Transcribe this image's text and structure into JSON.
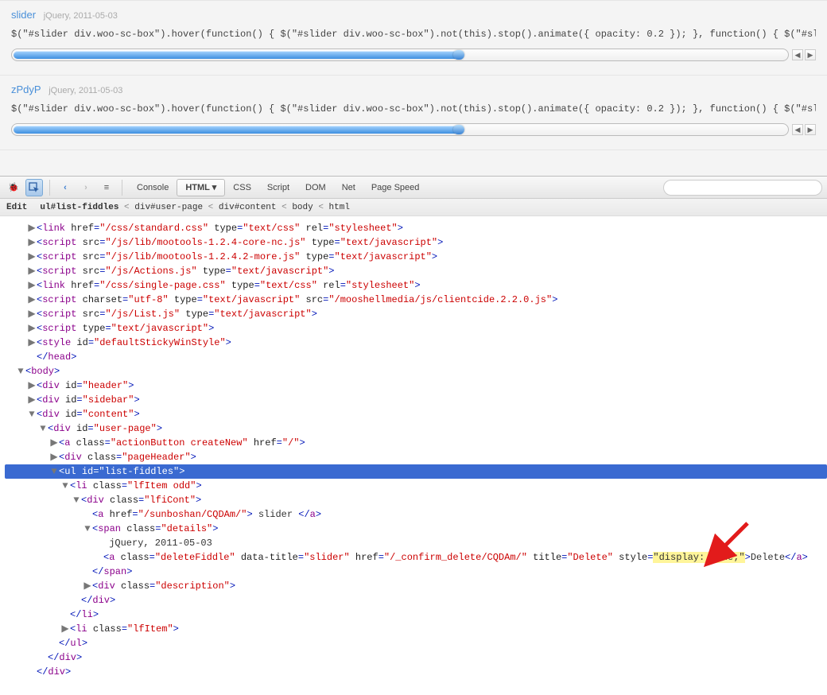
{
  "fiddles": [
    {
      "title": "slider",
      "meta": "jQuery, 2011-05-03",
      "code": "$(\"#slider div.woo-sc-box\").hover(function() { $(\"#slider div.woo-sc-box\").not(this).stop().animate({ opacity: 0.2 }); }, function() { $(\"#slider d"
    },
    {
      "title": "zPdyP",
      "meta": "jQuery, 2011-05-03",
      "code": "$(\"#slider div.woo-sc-box\").hover(function() { $(\"#slider div.woo-sc-box\").not(this).stop().animate({ opacity: 0.2 }); }, function() { $(\"#slider d"
    }
  ],
  "toolbar": {
    "tabs": [
      "Console",
      "HTML",
      "CSS",
      "Script",
      "DOM",
      "Net",
      "Page Speed"
    ],
    "active_tab_index": 1,
    "search_placeholder": ""
  },
  "breadcrumbs": {
    "edit": "Edit",
    "items": [
      "ul#list-fiddles",
      "div#user-page",
      "div#content",
      "body",
      "html"
    ],
    "sep": "<"
  },
  "tree": [
    {
      "d": 2,
      "tw": "▶",
      "html": [
        [
          "pun",
          "<"
        ],
        [
          "tag",
          "link"
        ],
        [
          "txt",
          " "
        ],
        [
          "attr",
          "href"
        ],
        [
          "pun",
          "="
        ],
        [
          "val",
          "\"/css/standard.css\""
        ],
        [
          "txt",
          " "
        ],
        [
          "attr",
          "type"
        ],
        [
          "pun",
          "="
        ],
        [
          "val",
          "\"text/css\""
        ],
        [
          "txt",
          " "
        ],
        [
          "attr",
          "rel"
        ],
        [
          "pun",
          "="
        ],
        [
          "val",
          "\"stylesheet\""
        ],
        [
          "pun",
          ">"
        ]
      ]
    },
    {
      "d": 2,
      "tw": "▶",
      "html": [
        [
          "pun",
          "<"
        ],
        [
          "tag",
          "script"
        ],
        [
          "txt",
          " "
        ],
        [
          "attr",
          "src"
        ],
        [
          "pun",
          "="
        ],
        [
          "val",
          "\"/js/lib/mootools-1.2.4-core-nc.js\""
        ],
        [
          "txt",
          " "
        ],
        [
          "attr",
          "type"
        ],
        [
          "pun",
          "="
        ],
        [
          "val",
          "\"text/javascript\""
        ],
        [
          "pun",
          ">"
        ]
      ]
    },
    {
      "d": 2,
      "tw": "▶",
      "html": [
        [
          "pun",
          "<"
        ],
        [
          "tag",
          "script"
        ],
        [
          "txt",
          " "
        ],
        [
          "attr",
          "src"
        ],
        [
          "pun",
          "="
        ],
        [
          "val",
          "\"/js/lib/mootools-1.2.4.2-more.js\""
        ],
        [
          "txt",
          " "
        ],
        [
          "attr",
          "type"
        ],
        [
          "pun",
          "="
        ],
        [
          "val",
          "\"text/javascript\""
        ],
        [
          "pun",
          ">"
        ]
      ]
    },
    {
      "d": 2,
      "tw": "▶",
      "html": [
        [
          "pun",
          "<"
        ],
        [
          "tag",
          "script"
        ],
        [
          "txt",
          " "
        ],
        [
          "attr",
          "src"
        ],
        [
          "pun",
          "="
        ],
        [
          "val",
          "\"/js/Actions.js\""
        ],
        [
          "txt",
          " "
        ],
        [
          "attr",
          "type"
        ],
        [
          "pun",
          "="
        ],
        [
          "val",
          "\"text/javascript\""
        ],
        [
          "pun",
          ">"
        ]
      ]
    },
    {
      "d": 2,
      "tw": "▶",
      "html": [
        [
          "pun",
          "<"
        ],
        [
          "tag",
          "link"
        ],
        [
          "txt",
          " "
        ],
        [
          "attr",
          "href"
        ],
        [
          "pun",
          "="
        ],
        [
          "val",
          "\"/css/single-page.css\""
        ],
        [
          "txt",
          " "
        ],
        [
          "attr",
          "type"
        ],
        [
          "pun",
          "="
        ],
        [
          "val",
          "\"text/css\""
        ],
        [
          "txt",
          " "
        ],
        [
          "attr",
          "rel"
        ],
        [
          "pun",
          "="
        ],
        [
          "val",
          "\"stylesheet\""
        ],
        [
          "pun",
          ">"
        ]
      ]
    },
    {
      "d": 2,
      "tw": "▶",
      "html": [
        [
          "pun",
          "<"
        ],
        [
          "tag",
          "script"
        ],
        [
          "txt",
          " "
        ],
        [
          "attr",
          "charset"
        ],
        [
          "pun",
          "="
        ],
        [
          "val",
          "\"utf-8\""
        ],
        [
          "txt",
          " "
        ],
        [
          "attr",
          "type"
        ],
        [
          "pun",
          "="
        ],
        [
          "val",
          "\"text/javascript\""
        ],
        [
          "txt",
          " "
        ],
        [
          "attr",
          "src"
        ],
        [
          "pun",
          "="
        ],
        [
          "val",
          "\"/mooshellmedia/js/clientcide.2.2.0.js\""
        ],
        [
          "pun",
          ">"
        ]
      ]
    },
    {
      "d": 2,
      "tw": "▶",
      "html": [
        [
          "pun",
          "<"
        ],
        [
          "tag",
          "script"
        ],
        [
          "txt",
          " "
        ],
        [
          "attr",
          "src"
        ],
        [
          "pun",
          "="
        ],
        [
          "val",
          "\"/js/List.js\""
        ],
        [
          "txt",
          " "
        ],
        [
          "attr",
          "type"
        ],
        [
          "pun",
          "="
        ],
        [
          "val",
          "\"text/javascript\""
        ],
        [
          "pun",
          ">"
        ]
      ]
    },
    {
      "d": 2,
      "tw": "▶",
      "html": [
        [
          "pun",
          "<"
        ],
        [
          "tag",
          "script"
        ],
        [
          "txt",
          " "
        ],
        [
          "attr",
          "type"
        ],
        [
          "pun",
          "="
        ],
        [
          "val",
          "\"text/javascript\""
        ],
        [
          "pun",
          ">"
        ]
      ]
    },
    {
      "d": 2,
      "tw": "▶",
      "html": [
        [
          "pun",
          "<"
        ],
        [
          "tag",
          "style"
        ],
        [
          "txt",
          " "
        ],
        [
          "attr",
          "id"
        ],
        [
          "pun",
          "="
        ],
        [
          "val",
          "\"defaultStickyWinStyle\""
        ],
        [
          "pun",
          ">"
        ]
      ]
    },
    {
      "d": 2,
      "tw": "",
      "html": [
        [
          "pun",
          "</"
        ],
        [
          "tag",
          "head"
        ],
        [
          "pun",
          ">"
        ]
      ]
    },
    {
      "d": 1,
      "tw": "▼",
      "html": [
        [
          "pun",
          "<"
        ],
        [
          "tag",
          "body"
        ],
        [
          "pun",
          ">"
        ]
      ]
    },
    {
      "d": 2,
      "tw": "▶",
      "html": [
        [
          "pun",
          "<"
        ],
        [
          "tag",
          "div"
        ],
        [
          "txt",
          " "
        ],
        [
          "attr",
          "id"
        ],
        [
          "pun",
          "="
        ],
        [
          "val",
          "\"header\""
        ],
        [
          "pun",
          ">"
        ]
      ]
    },
    {
      "d": 2,
      "tw": "▶",
      "html": [
        [
          "pun",
          "<"
        ],
        [
          "tag",
          "div"
        ],
        [
          "txt",
          " "
        ],
        [
          "attr",
          "id"
        ],
        [
          "pun",
          "="
        ],
        [
          "val",
          "\"sidebar\""
        ],
        [
          "pun",
          ">"
        ]
      ]
    },
    {
      "d": 2,
      "tw": "▼",
      "html": [
        [
          "pun",
          "<"
        ],
        [
          "tag",
          "div"
        ],
        [
          "txt",
          " "
        ],
        [
          "attr",
          "id"
        ],
        [
          "pun",
          "="
        ],
        [
          "val",
          "\"content\""
        ],
        [
          "pun",
          ">"
        ]
      ]
    },
    {
      "d": 3,
      "tw": "▼",
      "html": [
        [
          "pun",
          "<"
        ],
        [
          "tag",
          "div"
        ],
        [
          "txt",
          " "
        ],
        [
          "attr",
          "id"
        ],
        [
          "pun",
          "="
        ],
        [
          "val",
          "\"user-page\""
        ],
        [
          "pun",
          ">"
        ]
      ]
    },
    {
      "d": 4,
      "tw": "▶",
      "html": [
        [
          "pun",
          "<"
        ],
        [
          "tag",
          "a"
        ],
        [
          "txt",
          " "
        ],
        [
          "attr",
          "class"
        ],
        [
          "pun",
          "="
        ],
        [
          "val",
          "\"actionButton createNew\""
        ],
        [
          "txt",
          " "
        ],
        [
          "attr",
          "href"
        ],
        [
          "pun",
          "="
        ],
        [
          "val",
          "\"/\""
        ],
        [
          "pun",
          ">"
        ]
      ]
    },
    {
      "d": 4,
      "tw": "▶",
      "html": [
        [
          "pun",
          "<"
        ],
        [
          "tag",
          "div"
        ],
        [
          "txt",
          " "
        ],
        [
          "attr",
          "class"
        ],
        [
          "pun",
          "="
        ],
        [
          "val",
          "\"pageHeader\""
        ],
        [
          "pun",
          ">"
        ]
      ]
    },
    {
      "d": 4,
      "tw": "▼",
      "sel": true,
      "html": [
        [
          "pun",
          "<"
        ],
        [
          "tag",
          "ul"
        ],
        [
          "txt",
          " "
        ],
        [
          "attr",
          "id"
        ],
        [
          "pun",
          "="
        ],
        [
          "val",
          "\"list-fiddles\""
        ],
        [
          "pun",
          ">"
        ]
      ]
    },
    {
      "d": 5,
      "tw": "▼",
      "html": [
        [
          "pun",
          "<"
        ],
        [
          "tag",
          "li"
        ],
        [
          "txt",
          " "
        ],
        [
          "attr",
          "class"
        ],
        [
          "pun",
          "="
        ],
        [
          "val",
          "\"lfItem odd\""
        ],
        [
          "pun",
          ">"
        ]
      ]
    },
    {
      "d": 6,
      "tw": "▼",
      "html": [
        [
          "pun",
          "<"
        ],
        [
          "tag",
          "div"
        ],
        [
          "txt",
          " "
        ],
        [
          "attr",
          "class"
        ],
        [
          "pun",
          "="
        ],
        [
          "val",
          "\"lfiCont\""
        ],
        [
          "pun",
          ">"
        ]
      ]
    },
    {
      "d": 7,
      "tw": "",
      "html": [
        [
          "pun",
          "<"
        ],
        [
          "tag",
          "a"
        ],
        [
          "txt",
          " "
        ],
        [
          "attr",
          "href"
        ],
        [
          "pun",
          "="
        ],
        [
          "val",
          "\"/sunboshan/CQDAm/\""
        ],
        [
          "pun",
          ">"
        ],
        [
          "txt",
          " slider "
        ],
        [
          "pun",
          "</"
        ],
        [
          "tag",
          "a"
        ],
        [
          "pun",
          ">"
        ]
      ]
    },
    {
      "d": 7,
      "tw": "▼",
      "html": [
        [
          "pun",
          "<"
        ],
        [
          "tag",
          "span"
        ],
        [
          "txt",
          " "
        ],
        [
          "attr",
          "class"
        ],
        [
          "pun",
          "="
        ],
        [
          "val",
          "\"details\""
        ],
        [
          "pun",
          ">"
        ]
      ]
    },
    {
      "d": 8,
      "tw": "",
      "html": [
        [
          "txt",
          " jQuery, 2011-05-03"
        ]
      ]
    },
    {
      "d": 8,
      "tw": "",
      "html": [
        [
          "pun",
          "<"
        ],
        [
          "tag",
          "a"
        ],
        [
          "txt",
          " "
        ],
        [
          "attr",
          "class"
        ],
        [
          "pun",
          "="
        ],
        [
          "val",
          "\"deleteFiddle\""
        ],
        [
          "txt",
          " "
        ],
        [
          "attr",
          "data-title"
        ],
        [
          "pun",
          "="
        ],
        [
          "val",
          "\"slider\""
        ],
        [
          "txt",
          " "
        ],
        [
          "attr",
          "href"
        ],
        [
          "pun",
          "="
        ],
        [
          "val",
          "\"/_confirm_delete/CQDAm/\""
        ],
        [
          "txt",
          " "
        ],
        [
          "attr",
          "title"
        ],
        [
          "pun",
          "="
        ],
        [
          "val",
          "\"Delete\""
        ],
        [
          "txt",
          " "
        ],
        [
          "attr",
          "style"
        ],
        [
          "pun",
          "="
        ],
        [
          "hiatt",
          "\"display: none;\""
        ],
        [
          "pun",
          ">"
        ],
        [
          "txt",
          "Delete"
        ],
        [
          "pun",
          "</"
        ],
        [
          "tag",
          "a"
        ],
        [
          "pun",
          ">"
        ]
      ]
    },
    {
      "d": 7,
      "tw": "",
      "html": [
        [
          "pun",
          "</"
        ],
        [
          "tag",
          "span"
        ],
        [
          "pun",
          ">"
        ]
      ]
    },
    {
      "d": 7,
      "tw": "▶",
      "html": [
        [
          "pun",
          "<"
        ],
        [
          "tag",
          "div"
        ],
        [
          "txt",
          " "
        ],
        [
          "attr",
          "class"
        ],
        [
          "pun",
          "="
        ],
        [
          "val",
          "\"description\""
        ],
        [
          "pun",
          ">"
        ]
      ]
    },
    {
      "d": 6,
      "tw": "",
      "html": [
        [
          "pun",
          "</"
        ],
        [
          "tag",
          "div"
        ],
        [
          "pun",
          ">"
        ]
      ]
    },
    {
      "d": 5,
      "tw": "",
      "html": [
        [
          "pun",
          "</"
        ],
        [
          "tag",
          "li"
        ],
        [
          "pun",
          ">"
        ]
      ]
    },
    {
      "d": 5,
      "tw": "▶",
      "html": [
        [
          "pun",
          "<"
        ],
        [
          "tag",
          "li"
        ],
        [
          "txt",
          " "
        ],
        [
          "attr",
          "class"
        ],
        [
          "pun",
          "="
        ],
        [
          "val",
          "\"lfItem\""
        ],
        [
          "pun",
          ">"
        ]
      ]
    },
    {
      "d": 4,
      "tw": "",
      "html": [
        [
          "pun",
          "</"
        ],
        [
          "tag",
          "ul"
        ],
        [
          "pun",
          ">"
        ]
      ]
    },
    {
      "d": 3,
      "tw": "",
      "html": [
        [
          "pun",
          "</"
        ],
        [
          "tag",
          "div"
        ],
        [
          "pun",
          ">"
        ]
      ]
    },
    {
      "d": 2,
      "tw": "",
      "html": [
        [
          "pun",
          "</"
        ],
        [
          "tag",
          "div"
        ],
        [
          "pun",
          ">"
        ]
      ]
    }
  ]
}
